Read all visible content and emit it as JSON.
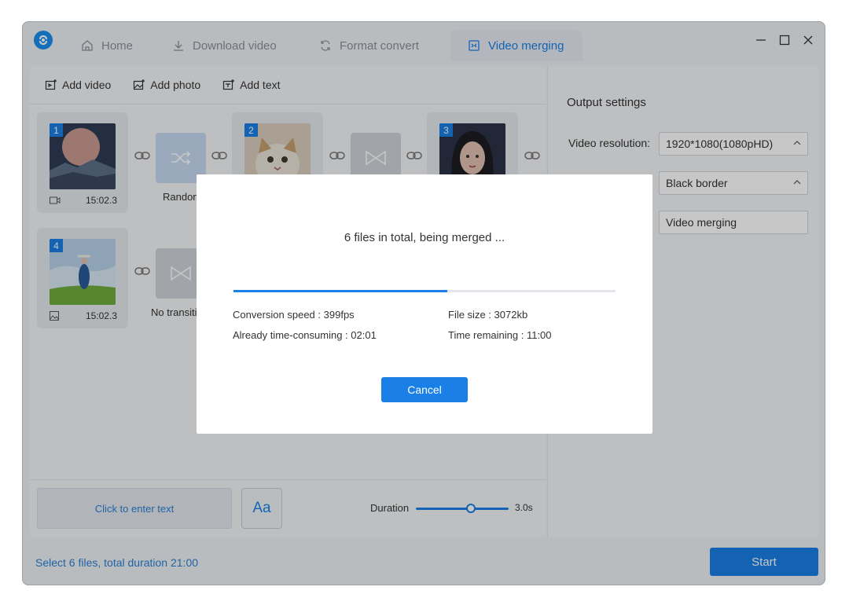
{
  "tabs": [
    {
      "label": "Home",
      "icon": "home-icon"
    },
    {
      "label": "Download video",
      "icon": "download-icon"
    },
    {
      "label": "Format convert",
      "icon": "refresh-icon"
    },
    {
      "label": "Video merging",
      "icon": "merge-icon",
      "active": true
    }
  ],
  "toolbar": {
    "add_video": "Add video",
    "add_photo": "Add photo",
    "add_text": "Add text"
  },
  "clips": [
    {
      "number": "1",
      "type": "video",
      "duration": "15:02.3",
      "thumbnail": "moon-over-mountains"
    },
    {
      "number": "2",
      "type": "photo",
      "duration": "",
      "thumbnail": "cat"
    },
    {
      "number": "3",
      "type": "photo",
      "duration": "",
      "thumbnail": "portrait-woman"
    },
    {
      "number": "4",
      "type": "photo",
      "duration": "15:02.3",
      "thumbnail": "girl-in-field"
    }
  ],
  "transitions": [
    {
      "label": "Randon",
      "icon": "shuffle-icon",
      "style": "blue"
    },
    {
      "label": "",
      "icon": "bowtie-icon",
      "style": "gray"
    },
    {
      "label": "No transiti",
      "icon": "bowtie-icon",
      "style": "gray"
    }
  ],
  "text_editor": {
    "placeholder": "Click to enter text",
    "font_button": "Aa",
    "duration_label": "Duration",
    "duration_value": "3.0s",
    "duration_fraction": 0.55
  },
  "settings": {
    "title": "Output settings",
    "resolution_label": "Video resolution:",
    "resolution_value": "1920*1080(1080pHD)",
    "border_value": "Black border",
    "name_value": "Video merging"
  },
  "footer": {
    "summary": "Select 6 files, total duration 21:00",
    "start": "Start"
  },
  "dialog": {
    "title": "6 files in total, being merged ...",
    "progress": 0.56,
    "speed_label": "Conversion speed :",
    "speed_value": "399fps",
    "size_label": "File size :",
    "size_value": "3072kb",
    "elapsed_label": "Already time-consuming :",
    "elapsed_value": "02:01",
    "remaining_label": "Time remaining :",
    "remaining_value": "11:00",
    "cancel": "Cancel"
  },
  "colors": {
    "accent": "#1a7fe6",
    "link_text": "#2a7fd4"
  }
}
